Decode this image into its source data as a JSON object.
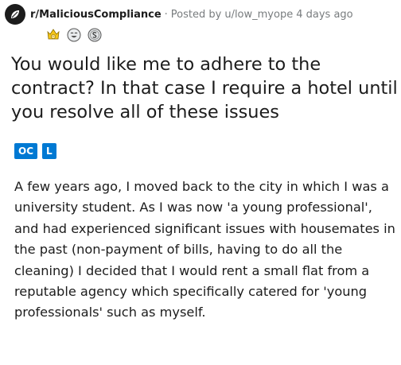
{
  "header": {
    "subreddit": "r/MaliciousCompliance",
    "separator": "·",
    "posted_by_prefix": "Posted by",
    "author": "u/low_myope",
    "time": "4 days ago"
  },
  "awards": [
    {
      "icon": "wholesome-award-icon",
      "color": "#f5c518"
    },
    {
      "icon": "laughing-award-icon",
      "color": "#cfd3d6"
    },
    {
      "icon": "silver-award-icon",
      "color": "#b8bcbf"
    }
  ],
  "post": {
    "title": "You would like me to adhere to the contract? In that case I require a hotel until you resolve all of these issues",
    "flairs": [
      "OC",
      "L"
    ],
    "body": "A few years ago, I moved back to the city in which I was a university student. As I was now 'a young professional', and had experienced significant issues with housemates in the past (non-payment of bills, having to do all the cleaning) I decided that I would rent a small flat from a reputable agency which specifically catered for 'young professionals' such as myself."
  },
  "colors": {
    "flair_bg": "#0079d3",
    "meta_text": "#787c7e",
    "text": "#1c1c1c"
  }
}
